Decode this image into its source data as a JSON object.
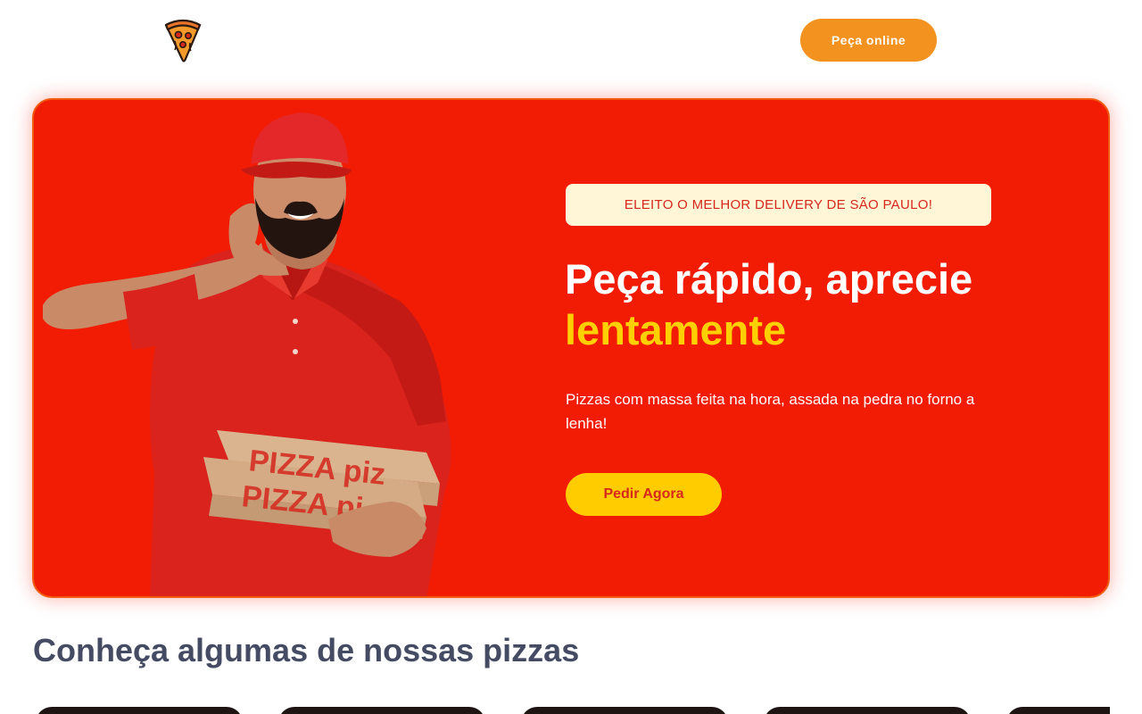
{
  "header": {
    "logo_icon": "pizza-slice-icon",
    "order_online_label": "Peça online",
    "order_online_color": "#f3921f"
  },
  "hero": {
    "background_color": "#f21b03",
    "image": "delivery-man-holding-pizza-boxes",
    "badge_text": "ELEITO O MELHOR DELIVERY DE SÃO PAULO!",
    "headline_line1": "Peça rápido, aprecie",
    "headline_accent": "lentamente",
    "accent_color": "#ffd000",
    "subtitle": "Pizzas com massa feita na hora, assada na pedra no forno a lenha!",
    "cta_label": "Pedir Agora"
  },
  "pizzas_section": {
    "title": "Conheça algumas de nossas pizzas"
  }
}
